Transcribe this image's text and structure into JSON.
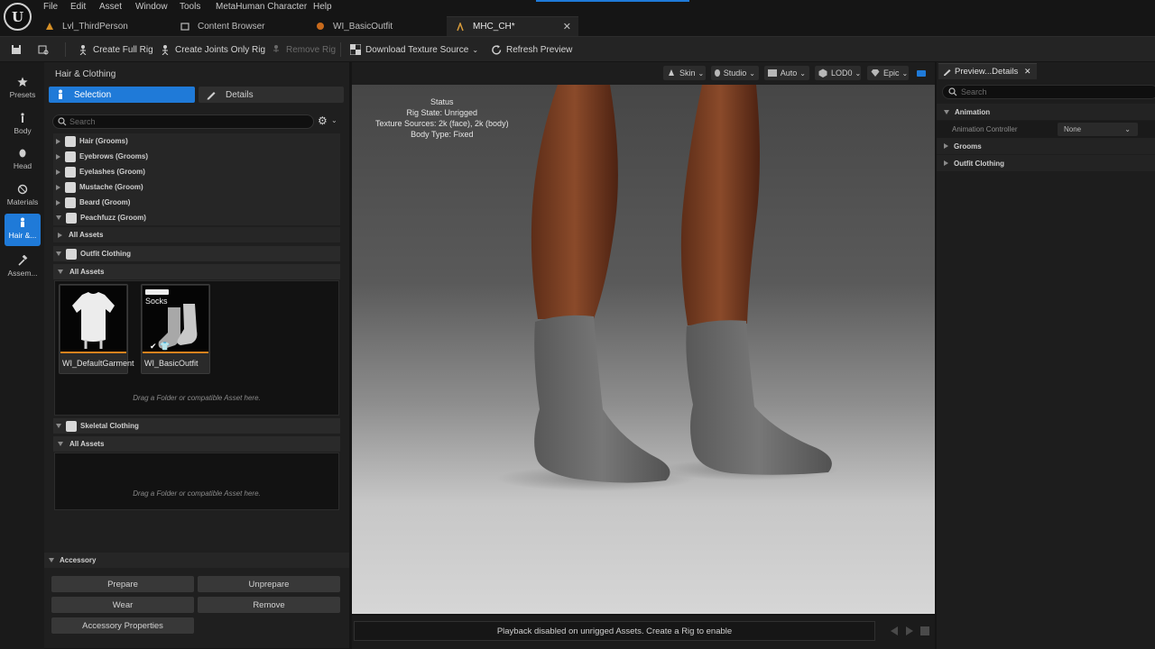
{
  "menu": [
    "File",
    "Edit",
    "Asset",
    "Window",
    "Tools",
    "MetaHuman Character",
    "Help"
  ],
  "tabs": [
    {
      "label": "Lvl_ThirdPerson"
    },
    {
      "label": "Content Browser"
    },
    {
      "label": "WI_BasicOutfit"
    },
    {
      "label": "MHC_CH*"
    }
  ],
  "toolbar": {
    "create_full_rig": "Create Full Rig",
    "create_joints_only_rig": "Create Joints Only Rig",
    "remove_rig": "Remove Rig",
    "download_texture_source": "Download Texture Source",
    "refresh_preview": "Refresh Preview"
  },
  "left_strip": [
    "Presets",
    "Body",
    "Head",
    "Materials",
    "Hair &...",
    "Assem..."
  ],
  "left_panel": {
    "title": "Hair & Clothing",
    "selection_label": "Selection",
    "details_label": "Details",
    "search_placeholder": "Search",
    "groom_items": [
      "Hair (Grooms)",
      "Eyebrows (Grooms)",
      "Eyelashes (Groom)",
      "Mustache (Groom)",
      "Beard (Groom)",
      "Peachfuzz (Groom)"
    ],
    "all_assets_collapsed": "All Assets",
    "outfit_clothing": "Outfit Clothing",
    "outfit_all_assets": "All Assets",
    "assets": [
      {
        "name": "WI_DefaultGarment"
      },
      {
        "name": "WI_BasicOutfit",
        "thumb_label": "Socks"
      }
    ],
    "drop_hint_1": "Drag a Folder or compatible Asset here.",
    "skeletal_clothing": "Skeletal Clothing",
    "skeletal_all_assets": "All Assets",
    "drop_hint_2": "Drag a Folder or compatible Asset here."
  },
  "accessory": {
    "header": "Accessory",
    "prepare": "Prepare",
    "unprepare": "Unprepare",
    "wear": "Wear",
    "remove": "Remove",
    "properties": "Accessory Properties"
  },
  "viewport": {
    "toolbar": {
      "skin": "Skin",
      "studio": "Studio",
      "auto": "Auto",
      "lod": "LOD0",
      "quality": "Epic"
    },
    "status_title": "Status",
    "rig_state": "Rig State: Unrigged",
    "texture_sources": "Texture Sources: 2k (face), 2k (body)",
    "body_type": "Body Type: Fixed",
    "playback_msg": "Playback disabled on unrigged Assets. Create a Rig to enable"
  },
  "right_panel": {
    "tab_label": "Preview...Details",
    "search_placeholder": "Search",
    "sections": {
      "animation": "Animation",
      "grooms": "Grooms",
      "outfit_clothing": "Outfit Clothing"
    },
    "animation_controller_label": "Animation Controller",
    "animation_controller_value": "None"
  },
  "colors": {
    "accent": "#1f7ad8",
    "thumb_underline": "#d8821e",
    "skin": "#7a3f24",
    "sock": "#6d6d6d"
  }
}
